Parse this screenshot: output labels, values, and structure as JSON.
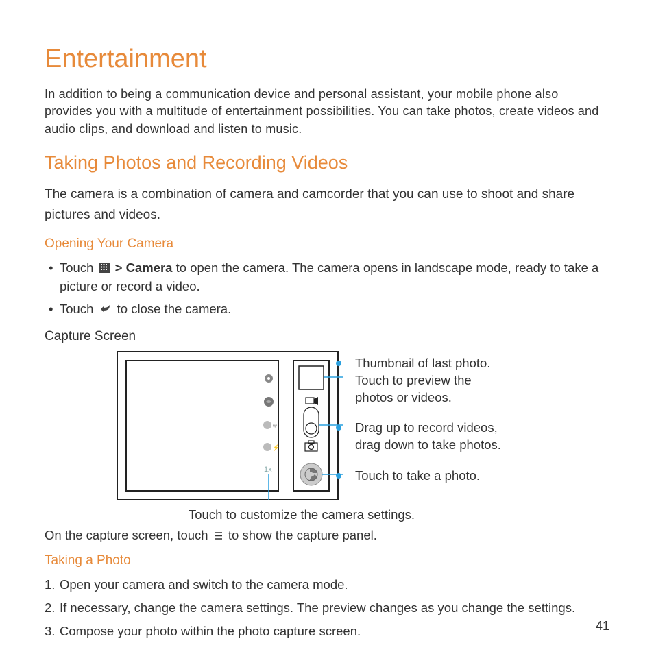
{
  "page": {
    "title": "Entertainment",
    "intro": "In addition to being a communication device and personal assistant, your mobile phone also provides you with a multitude of entertainment possibilities. You can take photos, create videos and audio clips, and download and listen to music.",
    "h2": "Taking Photos and Recording Videos",
    "h2_text": "The camera is a combination of camera and camcorder that you can use to shoot and share pictures and videos.",
    "h3_open": "Opening Your Camera",
    "bullet1_pre": "Touch",
    "bullet1_mid": " > Camera",
    "bullet1_post": " to open the camera. The camera opens in landscape mode, ready to take a picture or record a video.",
    "bullet2_pre": "Touch",
    "bullet2_post": " to close the camera.",
    "capture_label": "Capture Screen",
    "callout1": "Thumbnail of last photo. Touch to preview the photos or videos.",
    "callout2": "Drag up to record videos, drag down to take photos.",
    "callout3": "Touch to take a photo.",
    "callout4": "Touch to customize the camera settings.",
    "capture_text_pre": "On the capture screen, touch",
    "capture_text_post": " to show the capture panel.",
    "h3_photo": "Taking a Photo",
    "step1": "Open your camera and switch to the camera mode.",
    "step2": "If necessary, change the camera settings. The preview changes as you change the settings.",
    "step3": "Compose your photo within the photo capture screen.",
    "zoom_label": "1x",
    "page_number": "41"
  }
}
